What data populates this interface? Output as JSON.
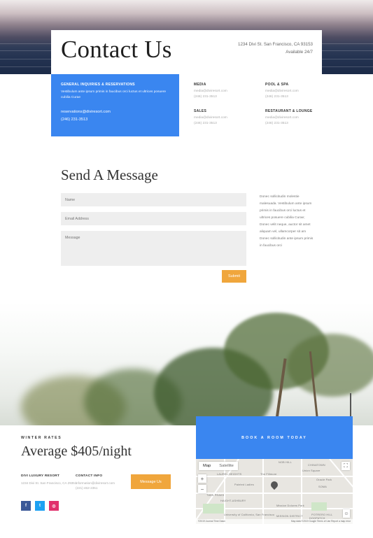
{
  "header": {
    "title": "Contact Us",
    "address": "1234 Divi St. San Francisco, CA 93153",
    "availability": "Available 24/7"
  },
  "general": {
    "title": "GENERAL INQUIRIES & RESERVATIONS",
    "description": "Vestibulum ante ipsum primis in faucibus orci luctus et ultrices posuere cubilia Curae",
    "email": "reservations@diviresort.com",
    "phone": "(246) 231-3513"
  },
  "departments": [
    {
      "name": "MEDIA",
      "email": "media@diviresort.com",
      "phone": "(246) 231-3513"
    },
    {
      "name": "POOL & SPA",
      "email": "media@diviresort.com",
      "phone": "(246) 231-3513"
    },
    {
      "name": "SALES",
      "email": "media@diviresort.com",
      "phone": "(246) 231-3513"
    },
    {
      "name": "RESTAURANT & LOUNGE",
      "email": "media@diviresort.com",
      "phone": "(246) 231-3513"
    }
  ],
  "form": {
    "heading": "Send A Message",
    "name_placeholder": "Name",
    "email_placeholder": "Email Address",
    "message_placeholder": "Message",
    "submit_label": "Submit",
    "side_text": "Donec sollicitudin molestie malesuada. Vestibulum ante ipsum primis in faucibus orci luctus et ultrices posuere cubilia Curae; Donec velit neque, auctor sit amet aliquam vel, ullamcorper sit am Donec sollicitudin ante ipsum primis in faucibus orci"
  },
  "rates": {
    "label": "WINTER RATES",
    "price": "Average $405/night"
  },
  "resort": {
    "title": "DIVI LUXURY RESORT",
    "address": "1234 Divi St. San Francisco, CA 29351"
  },
  "contact": {
    "title": "CONTACT INFO",
    "email": "information@diviresort.com",
    "phone": "(221) 462-2351"
  },
  "message_button": "Message Us",
  "social": [
    {
      "icon": "facebook-icon",
      "glyph": "f",
      "color": "#3b5998"
    },
    {
      "icon": "twitter-icon",
      "glyph": "t",
      "color": "#1da1f2"
    },
    {
      "icon": "instagram-icon",
      "glyph": "◎",
      "color": "#e1306c"
    }
  ],
  "book": {
    "label": "BOOK A ROOM TODAY"
  },
  "map": {
    "tab_map": "Map",
    "tab_satellite": "Satellite",
    "zoom_in": "+",
    "zoom_out": "−",
    "labels": [
      "NOB HILL",
      "LAUREL HEIGHTS",
      "The Fillmore",
      "Painted Ladies",
      "HAIGHT-ASHBURY",
      "University of California, San Francisco",
      "Mission Dolores Park",
      "MISSION DISTRICT",
      "Union Square",
      "SOMA",
      "CHINATOWN",
      "POTRERO HILL",
      "Oracle Park",
      "DOGPATCH",
      "TWIN PEAKS"
    ],
    "footer_left": "©2019 Journal Time Dawn",
    "footer_right": "Map data ©2019 Google   Terms of Use   Report a map error"
  },
  "colors": {
    "accent_blue": "#3a86f0",
    "accent_orange": "#f0a63c"
  }
}
